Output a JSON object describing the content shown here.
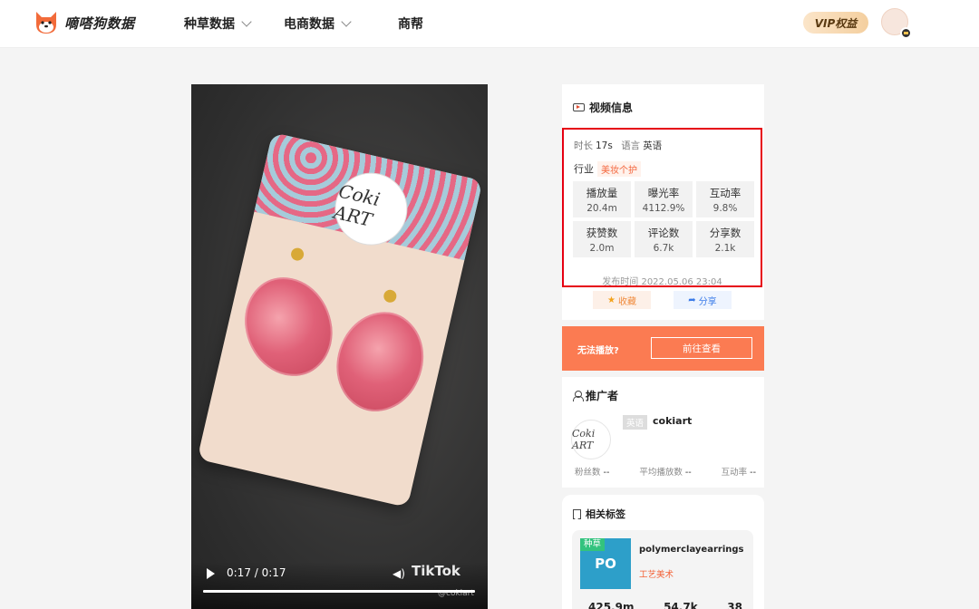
{
  "header": {
    "logo_text": "嘀嗒狗数据",
    "nav": [
      "种草数据",
      "电商数据",
      "商帮"
    ],
    "vip_label": "VIP权益"
  },
  "video": {
    "time": "0:17 / 0:17",
    "watermark": "TikTok",
    "watermark_user": "@cokiart",
    "card_logo": "Coki ART",
    "progress": 1.0
  },
  "video_info": {
    "title": "视频信息",
    "duration_label": "时长",
    "duration_value": "17s",
    "language_label": "语言",
    "language_value": "英语",
    "industry_label": "行业",
    "industry_value": "美妆个护",
    "stats": [
      {
        "label": "播放量",
        "value": "20.4m"
      },
      {
        "label": "曝光率",
        "value": "4112.9%"
      },
      {
        "label": "互动率",
        "value": "9.8%"
      },
      {
        "label": "获赞数",
        "value": "2.0m"
      },
      {
        "label": "评论数",
        "value": "6.7k"
      },
      {
        "label": "分享数",
        "value": "2.1k"
      }
    ],
    "publish_time": "发布时间 2022.05.06 23:04",
    "fav_label": "收藏",
    "share_label": "分享"
  },
  "cannot_play": {
    "text": "无法播放?",
    "button": "前往查看"
  },
  "promoter": {
    "title": "推广者",
    "language": "英语",
    "name": "cokiart",
    "avatar_text": "Coki ART",
    "fans_label": "粉丝数",
    "fans_value": "--",
    "avg_play_label": "平均播放数",
    "avg_play_value": "--",
    "interaction_label": "互动率",
    "interaction_value": "--"
  },
  "related_tags": {
    "title": "相关标签",
    "tag_badge": "种草",
    "tag_thumb": "PO",
    "tag_name": "polymerclayearrings",
    "tag_category": "工艺美术",
    "nums": [
      "425.9m",
      "54.7k",
      "38"
    ]
  },
  "colors": {
    "accent": "#fb7b52",
    "highlight_border": "#e60012",
    "industry_tag": "#f3643a"
  }
}
